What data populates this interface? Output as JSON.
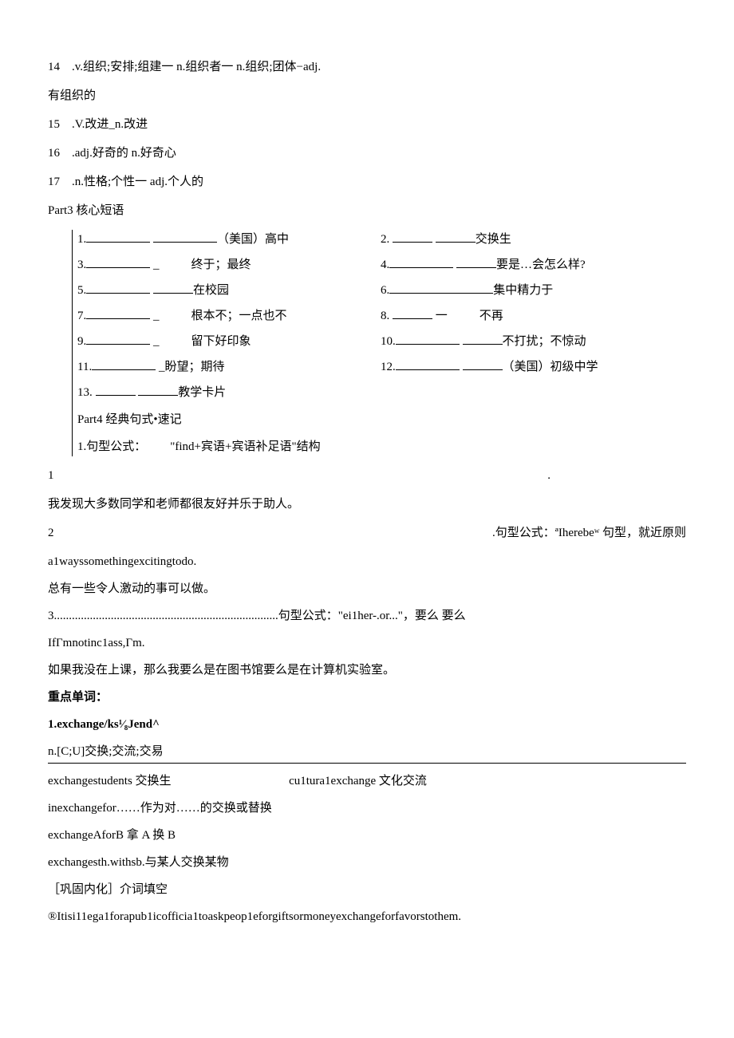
{
  "vocab": {
    "l14": "14 .v.组织;安排;组建一 n.组织者一 n.组织;团体−adj.",
    "l14b": "有组织的",
    "l15": "15 .V.改进_n.改进",
    "l16": "16 .adj.好奇的 n.好奇心",
    "l17": "17 .n.性格;个性一 adj.个人的"
  },
  "part3_title": "Part3 核心短语",
  "phrases": {
    "p1": "（美国）高中",
    "p2": "交换生",
    "p3": "终于；最终",
    "p4": "要是…会怎么样?",
    "p5": "在校园",
    "p6": "集中精力于",
    "p7": "根本不；一点也不",
    "p8": "不再",
    "p9": "留下好印象",
    "p10": "不打扰；不惊动",
    "p11": "盼望；期待",
    "p12": "（美国）初级中学",
    "p13": "教学卡片"
  },
  "part4_title": "Part4 经典句式•速记",
  "part4_l1": "1.句型公式：  \"find+宾语+宾语补足语\"结构",
  "body": {
    "b1a": "1",
    "b1dot": ".",
    "b1c": "我发现大多数同学和老师都很友好并乐于助人。",
    "b2a": "2",
    "b2b": ".句型公式：ªIherebeʷ 句型，就近原则",
    "b3": "a1wayssomethingexcitingtodo.",
    "b4": "总有一些令人激动的事可以做。",
    "b5": "3...........................................................................句型公式：\"ei1her-.or...\"，要么  要么",
    "b6": "IfΓmnotinc1ass,Γm.",
    "b7": "如果我没在上课，那么我要么是在图书馆要么是在计算机实验室。"
  },
  "keywords_hdr": "重点单词：",
  "kw1": "1.exchange/ks¹⁄₈Jend^",
  "kw1_def": "n.[C;U]交换;交流;交易",
  "kw_lines": {
    "a": "exchangestudents 交换生",
    "b": "cu1tura1exchange 文化交流",
    "c": "inexchangefor……作为对……的交换或替换",
    "d": "exchangeAforB 拿 A 换 B",
    "e": "exchangesth.withsb.与某人交换某物"
  },
  "practice_hdr": "［巩固内化］介词填空",
  "practice_q": "®Itisi11ega1forapub1icofficia1toaskpeop1eforgiftsormoneyexchangeforfavorstothem."
}
